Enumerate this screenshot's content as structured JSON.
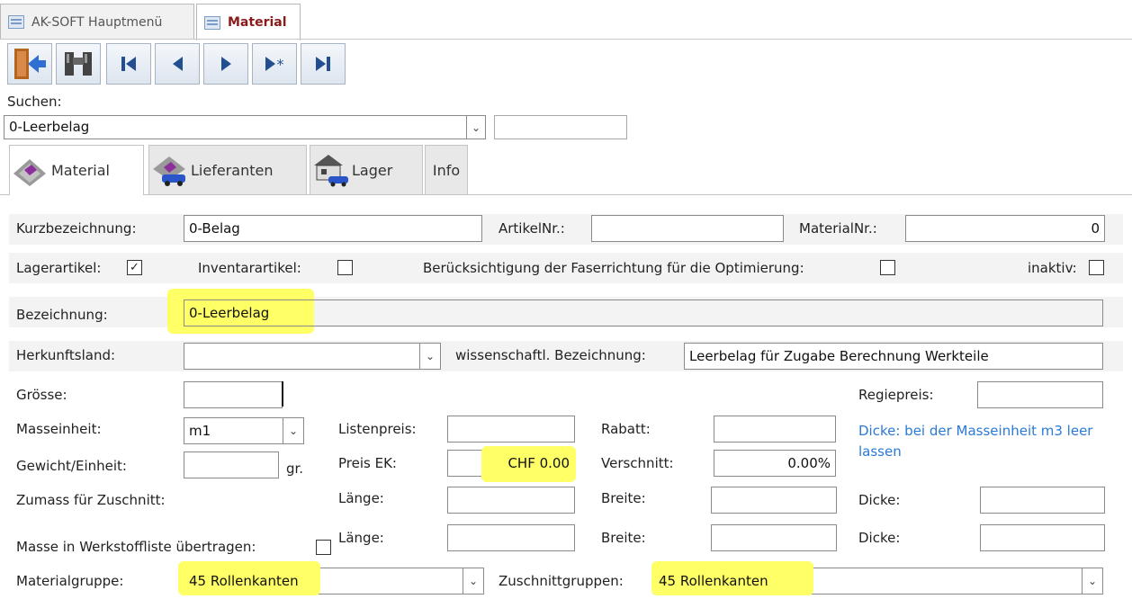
{
  "doc_tabs": [
    {
      "label": "AK-SOFT Hauptmenü",
      "active": false
    },
    {
      "label": "Material",
      "active": true
    }
  ],
  "toolbar": {
    "buttons": [
      "exit-icon",
      "binoculars-icon",
      "first-record-icon",
      "previous-record-icon",
      "next-record-icon",
      "new-record-icon",
      "last-record-icon"
    ]
  },
  "search": {
    "label": "Suchen:",
    "value": "0-Leerbelag",
    "extra_value": ""
  },
  "form_tabs": [
    "Material",
    "Lieferanten",
    "Lager",
    "Info"
  ],
  "fields": {
    "kurzbezeichnung": {
      "label": "Kurzbezeichnung:",
      "value": "0-Belag"
    },
    "artikelnr": {
      "label": "ArtikelNr.:",
      "value": ""
    },
    "materialnr": {
      "label": "MaterialNr.:",
      "value": "0"
    },
    "lagerartikel": {
      "label": "Lagerartikel:",
      "checked": true,
      "mark": "✓"
    },
    "inventarartikel": {
      "label": "Inventarartikel:",
      "checked": false
    },
    "faserrichtung": {
      "label": "Berücksichtigung der Faserrichtung für die Optimierung:",
      "checked": false
    },
    "inaktiv": {
      "label": "inaktiv:",
      "checked": false
    },
    "bezeichnung": {
      "label": "Bezeichnung:",
      "value": "0-Leerbelag"
    },
    "herkunftsland": {
      "label": "Herkunftsland:",
      "value": ""
    },
    "wissenschaftl": {
      "label": "wissenschaftl. Bezeichnung:",
      "value": "Leerbelag für Zugabe Berechnung Werkteile"
    },
    "groesse": {
      "label": "Grösse:",
      "value": ""
    },
    "regiepreis": {
      "label": "Regiepreis:",
      "value": ""
    },
    "masseinheit": {
      "label": "Masseinheit:",
      "value": "m1"
    },
    "listenpreis": {
      "label": "Listenpreis:",
      "value": ""
    },
    "rabatt": {
      "label": "Rabatt:",
      "value": ""
    },
    "hint": "Dicke: bei der Masseinheit m3 leer lassen",
    "gewicht": {
      "label": "Gewicht/Einheit:",
      "value": "",
      "unit": "gr."
    },
    "preis_ek": {
      "label": "Preis EK:",
      "value": "CHF 0.00"
    },
    "verschnitt": {
      "label": "Verschnitt:",
      "value": "0.00%"
    },
    "zumass": {
      "label": "Zumass für Zuschnitt:"
    },
    "laenge1": {
      "label": "Länge:",
      "value": ""
    },
    "breite1": {
      "label": "Breite:",
      "value": ""
    },
    "dicke1": {
      "label": "Dicke:",
      "value": ""
    },
    "masse_werkstoff": {
      "label": "Masse in Werkstoffliste übertragen:",
      "checked": false
    },
    "laenge2": {
      "label": "Länge:",
      "value": ""
    },
    "breite2": {
      "label": "Breite:",
      "value": ""
    },
    "dicke2": {
      "label": "Dicke:",
      "value": ""
    },
    "materialgruppe": {
      "label": "Materialgruppe:",
      "value": "45 Rollenkanten"
    },
    "zuschnittgruppen": {
      "label": "Zuschnittgruppen:",
      "value": "45 Rollenkanten"
    }
  },
  "colors": {
    "highlight": "#ffff66",
    "hint": "#2a7ad6",
    "active_tab_text": "#8b1a1a"
  }
}
